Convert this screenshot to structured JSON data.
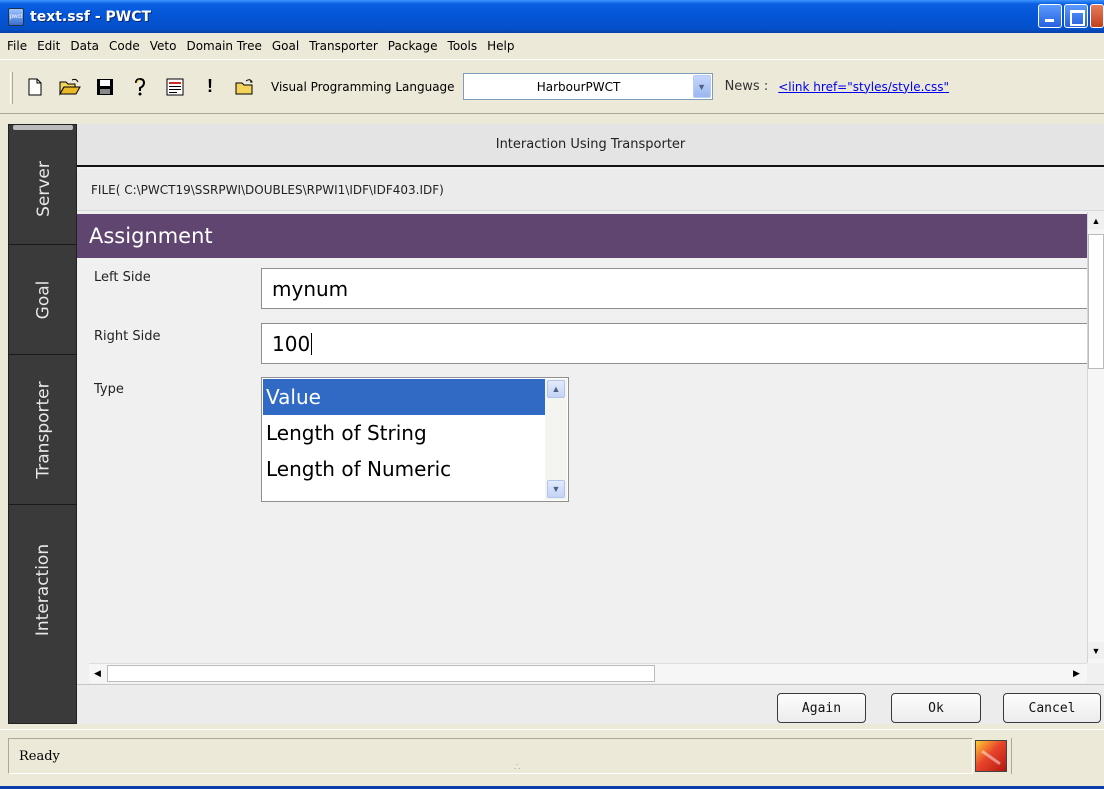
{
  "window": {
    "title": "text.ssf  - PWCT",
    "icon_text": "pwct"
  },
  "menu": [
    "File",
    "Edit",
    "Data",
    "Code",
    "Veto",
    "Domain Tree",
    "Goal",
    "Transporter",
    "Package",
    "Tools",
    "Help"
  ],
  "toolbar": {
    "icons": [
      "new-file-icon",
      "open-folder-icon",
      "save-icon",
      "help-icon",
      "document-icon",
      "exclamation-icon",
      "open-file-icon"
    ],
    "exclamation_label": "!",
    "vpl_label": "Visual Programming Language",
    "vpl_value": "HarbourPWCT",
    "news_label": "News :",
    "news_link": "<link href=\"styles/style.css\""
  },
  "side_tabs": [
    "Server",
    "Goal",
    "Transporter",
    "Interaction"
  ],
  "panel": {
    "title": "Interaction Using Transporter",
    "file_path": "FILE( C:\\PWCT19\\SSRPWI\\DOUBLES\\RPWI1\\IDF\\IDF403.IDF)"
  },
  "form": {
    "section_title": "Assignment",
    "left_side_label": "Left Side",
    "left_side_value": "mynum",
    "right_side_label": "Right Side",
    "right_side_value": "100",
    "type_label": "Type",
    "type_options": [
      "Value",
      "Length of String",
      "Length of Numeric"
    ],
    "type_selected": "Value"
  },
  "buttons": {
    "again": "Again",
    "ok": "Ok",
    "cancel": "Cancel"
  },
  "status": {
    "text": "Ready"
  },
  "colors": {
    "section_header": "#604570",
    "selection": "#316ac5",
    "side_panel": "#3a3a3a"
  }
}
